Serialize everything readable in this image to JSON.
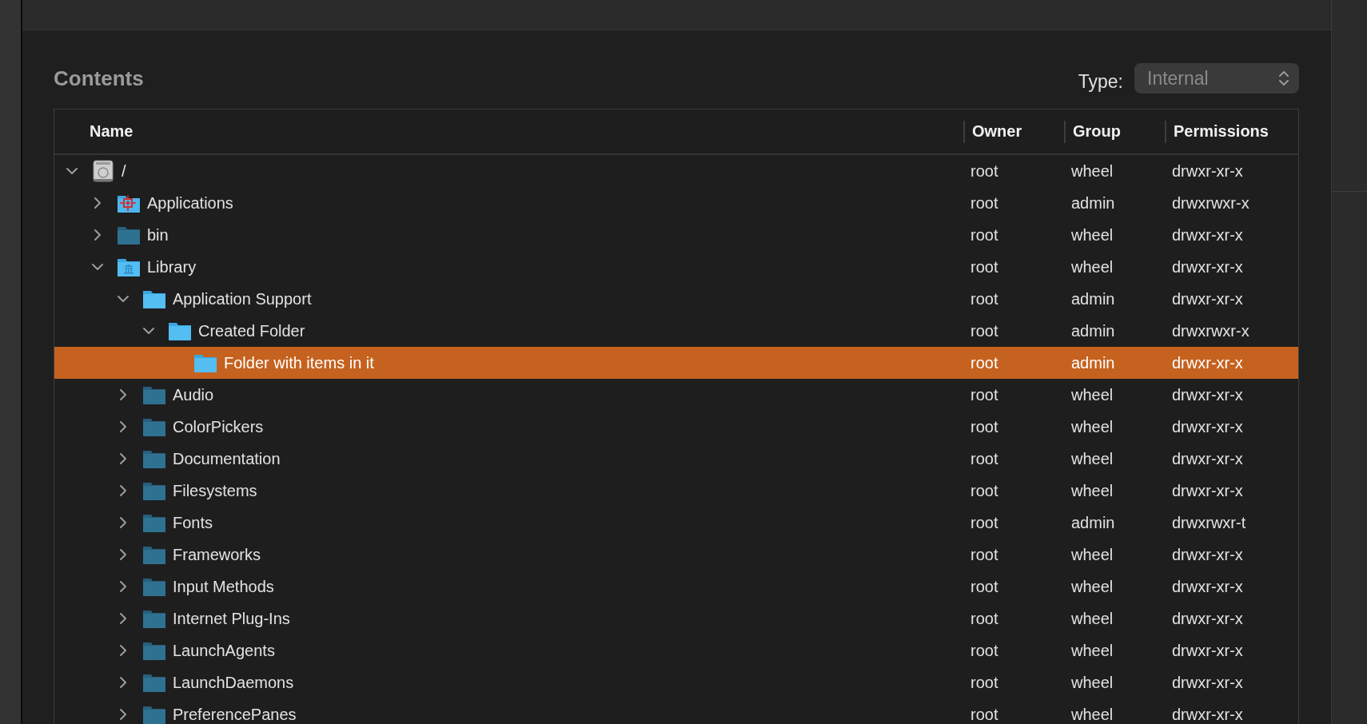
{
  "contents": {
    "title": "Contents",
    "type_label": "Type:",
    "type_select": {
      "value": "Internal",
      "disabled": true
    }
  },
  "table": {
    "columns": [
      "Name",
      "Owner",
      "Group",
      "Permissions"
    ],
    "rows": [
      {
        "name": "/",
        "kind": "disk",
        "owner": "root",
        "group": "wheel",
        "permissions": "drwxr-xr-x",
        "selected": false,
        "expanded": true,
        "children": [
          {
            "name": "Applications",
            "kind": "applications",
            "owner": "root",
            "group": "admin",
            "permissions": "drwxrwxr-x",
            "selected": false,
            "expanded": false
          },
          {
            "name": "bin",
            "kind": "system-folder",
            "owner": "root",
            "group": "wheel",
            "permissions": "drwxr-xr-x",
            "selected": false,
            "expanded": false
          },
          {
            "name": "Library",
            "kind": "library",
            "owner": "root",
            "group": "wheel",
            "permissions": "drwxr-xr-x",
            "selected": false,
            "expanded": true,
            "children": [
              {
                "name": "Application Support",
                "kind": "folder",
                "owner": "root",
                "group": "admin",
                "permissions": "drwxr-xr-x",
                "selected": false,
                "expanded": true,
                "children": [
                  {
                    "name": "Created Folder",
                    "kind": "folder",
                    "owner": "root",
                    "group": "admin",
                    "permissions": "drwxrwxr-x",
                    "selected": false,
                    "expanded": true,
                    "children": [
                      {
                        "name": "Folder with items in it",
                        "kind": "folder",
                        "owner": "root",
                        "group": "admin",
                        "permissions": "drwxr-xr-x",
                        "selected": true
                      }
                    ]
                  }
                ]
              },
              {
                "name": "Audio",
                "kind": "system-folder",
                "owner": "root",
                "group": "wheel",
                "permissions": "drwxr-xr-x",
                "selected": false,
                "expanded": false
              },
              {
                "name": "ColorPickers",
                "kind": "system-folder",
                "owner": "root",
                "group": "wheel",
                "permissions": "drwxr-xr-x",
                "selected": false,
                "expanded": false
              },
              {
                "name": "Documentation",
                "kind": "system-folder",
                "owner": "root",
                "group": "wheel",
                "permissions": "drwxr-xr-x",
                "selected": false,
                "expanded": false
              },
              {
                "name": "Filesystems",
                "kind": "system-folder",
                "owner": "root",
                "group": "wheel",
                "permissions": "drwxr-xr-x",
                "selected": false,
                "expanded": false
              },
              {
                "name": "Fonts",
                "kind": "system-folder",
                "owner": "root",
                "group": "admin",
                "permissions": "drwxrwxr-t",
                "selected": false,
                "expanded": false
              },
              {
                "name": "Frameworks",
                "kind": "system-folder",
                "owner": "root",
                "group": "wheel",
                "permissions": "drwxr-xr-x",
                "selected": false,
                "expanded": false
              },
              {
                "name": "Input Methods",
                "kind": "system-folder",
                "owner": "root",
                "group": "wheel",
                "permissions": "drwxr-xr-x",
                "selected": false,
                "expanded": false
              },
              {
                "name": "Internet Plug-Ins",
                "kind": "system-folder",
                "owner": "root",
                "group": "wheel",
                "permissions": "drwxr-xr-x",
                "selected": false,
                "expanded": false
              },
              {
                "name": "LaunchAgents",
                "kind": "system-folder",
                "owner": "root",
                "group": "wheel",
                "permissions": "drwxr-xr-x",
                "selected": false,
                "expanded": false
              },
              {
                "name": "LaunchDaemons",
                "kind": "system-folder",
                "owner": "root",
                "group": "wheel",
                "permissions": "drwxr-xr-x",
                "selected": false,
                "expanded": false
              },
              {
                "name": "PreferencePanes",
                "kind": "system-folder",
                "owner": "root",
                "group": "wheel",
                "permissions": "drwxr-xr-x",
                "selected": false,
                "expanded": false
              }
            ]
          }
        ]
      }
    ]
  }
}
